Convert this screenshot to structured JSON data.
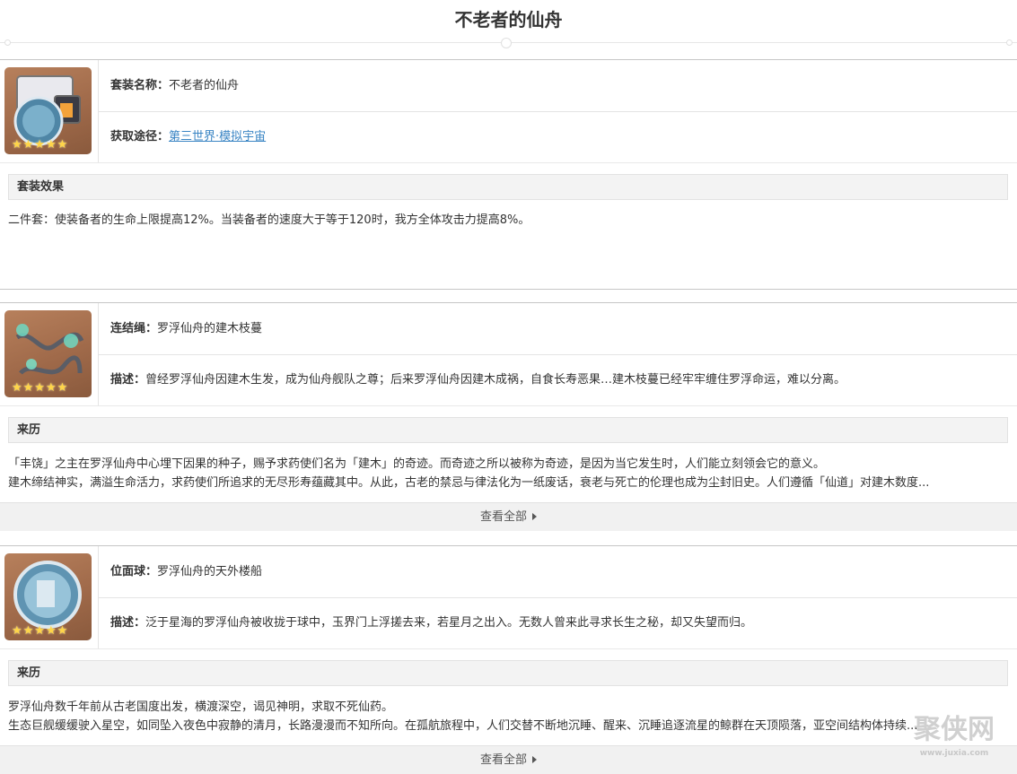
{
  "page_title": "不老者的仙舟",
  "set_info": {
    "name_label": "套装名称：",
    "name_value": "不老者的仙舟",
    "source_label": "获取途径：",
    "source_link": "第三世界·模拟宇宙",
    "stars": "★★★★★",
    "effect_heading": "套装效果",
    "effect_text": "二件套：使装备者的生命上限提高12%。当装备者的速度大于等于120时，我方全体攻击力提高8%。"
  },
  "pieces": [
    {
      "type_label": "连结绳：",
      "name": "罗浮仙舟的建木枝蔓",
      "desc_label": "描述：",
      "desc": "曾经罗浮仙舟因建木生发，成为仙舟舰队之尊；后来罗浮仙舟因建木成祸，自食长寿恶果…建木枝蔓已经牢牢缠住罗浮命运，难以分离。",
      "stars": "★★★★★",
      "history_heading": "来历",
      "history_lines": [
        "「丰饶」之主在罗浮仙舟中心埋下因果的种子，赐予求药使们名为「建木」的奇迹。而奇迹之所以被称为奇迹，是因为当它发生时，人们能立刻领会它的意义。",
        "建木缔结神实，满溢生命活力，求药使们所追求的无尽形寿蕴藏其中。从此，古老的禁忌与律法化为一纸废话，衰老与死亡的伦理也成为尘封旧史。人们遵循「仙道」对建木数度..."
      ],
      "more_label": "查看全部"
    },
    {
      "type_label": "位面球：",
      "name": "罗浮仙舟的天外楼船",
      "desc_label": "描述：",
      "desc": "泛于星海的罗浮仙舟被收拢于球中，玉界门上浮搓去来，若星月之出入。无数人曾来此寻求长生之秘，却又失望而归。",
      "stars": "★★★★★",
      "history_heading": "来历",
      "history_lines": [
        "罗浮仙舟数千年前从古老国度出发，横渡深空，谒见神明，求取不死仙药。",
        "生态巨舰缓缓驶入星空，如同坠入夜色中寂静的清月，长路漫漫而不知所向。在孤航旅程中，人们交替不断地沉睡、醒来、沉睡追逐流星的鲸群在天顶陨落，亚空间结构体持续..."
      ],
      "more_label": "查看全部"
    }
  ],
  "watermark": {
    "brand": "聚侠网",
    "url": "www.juxia.com"
  }
}
